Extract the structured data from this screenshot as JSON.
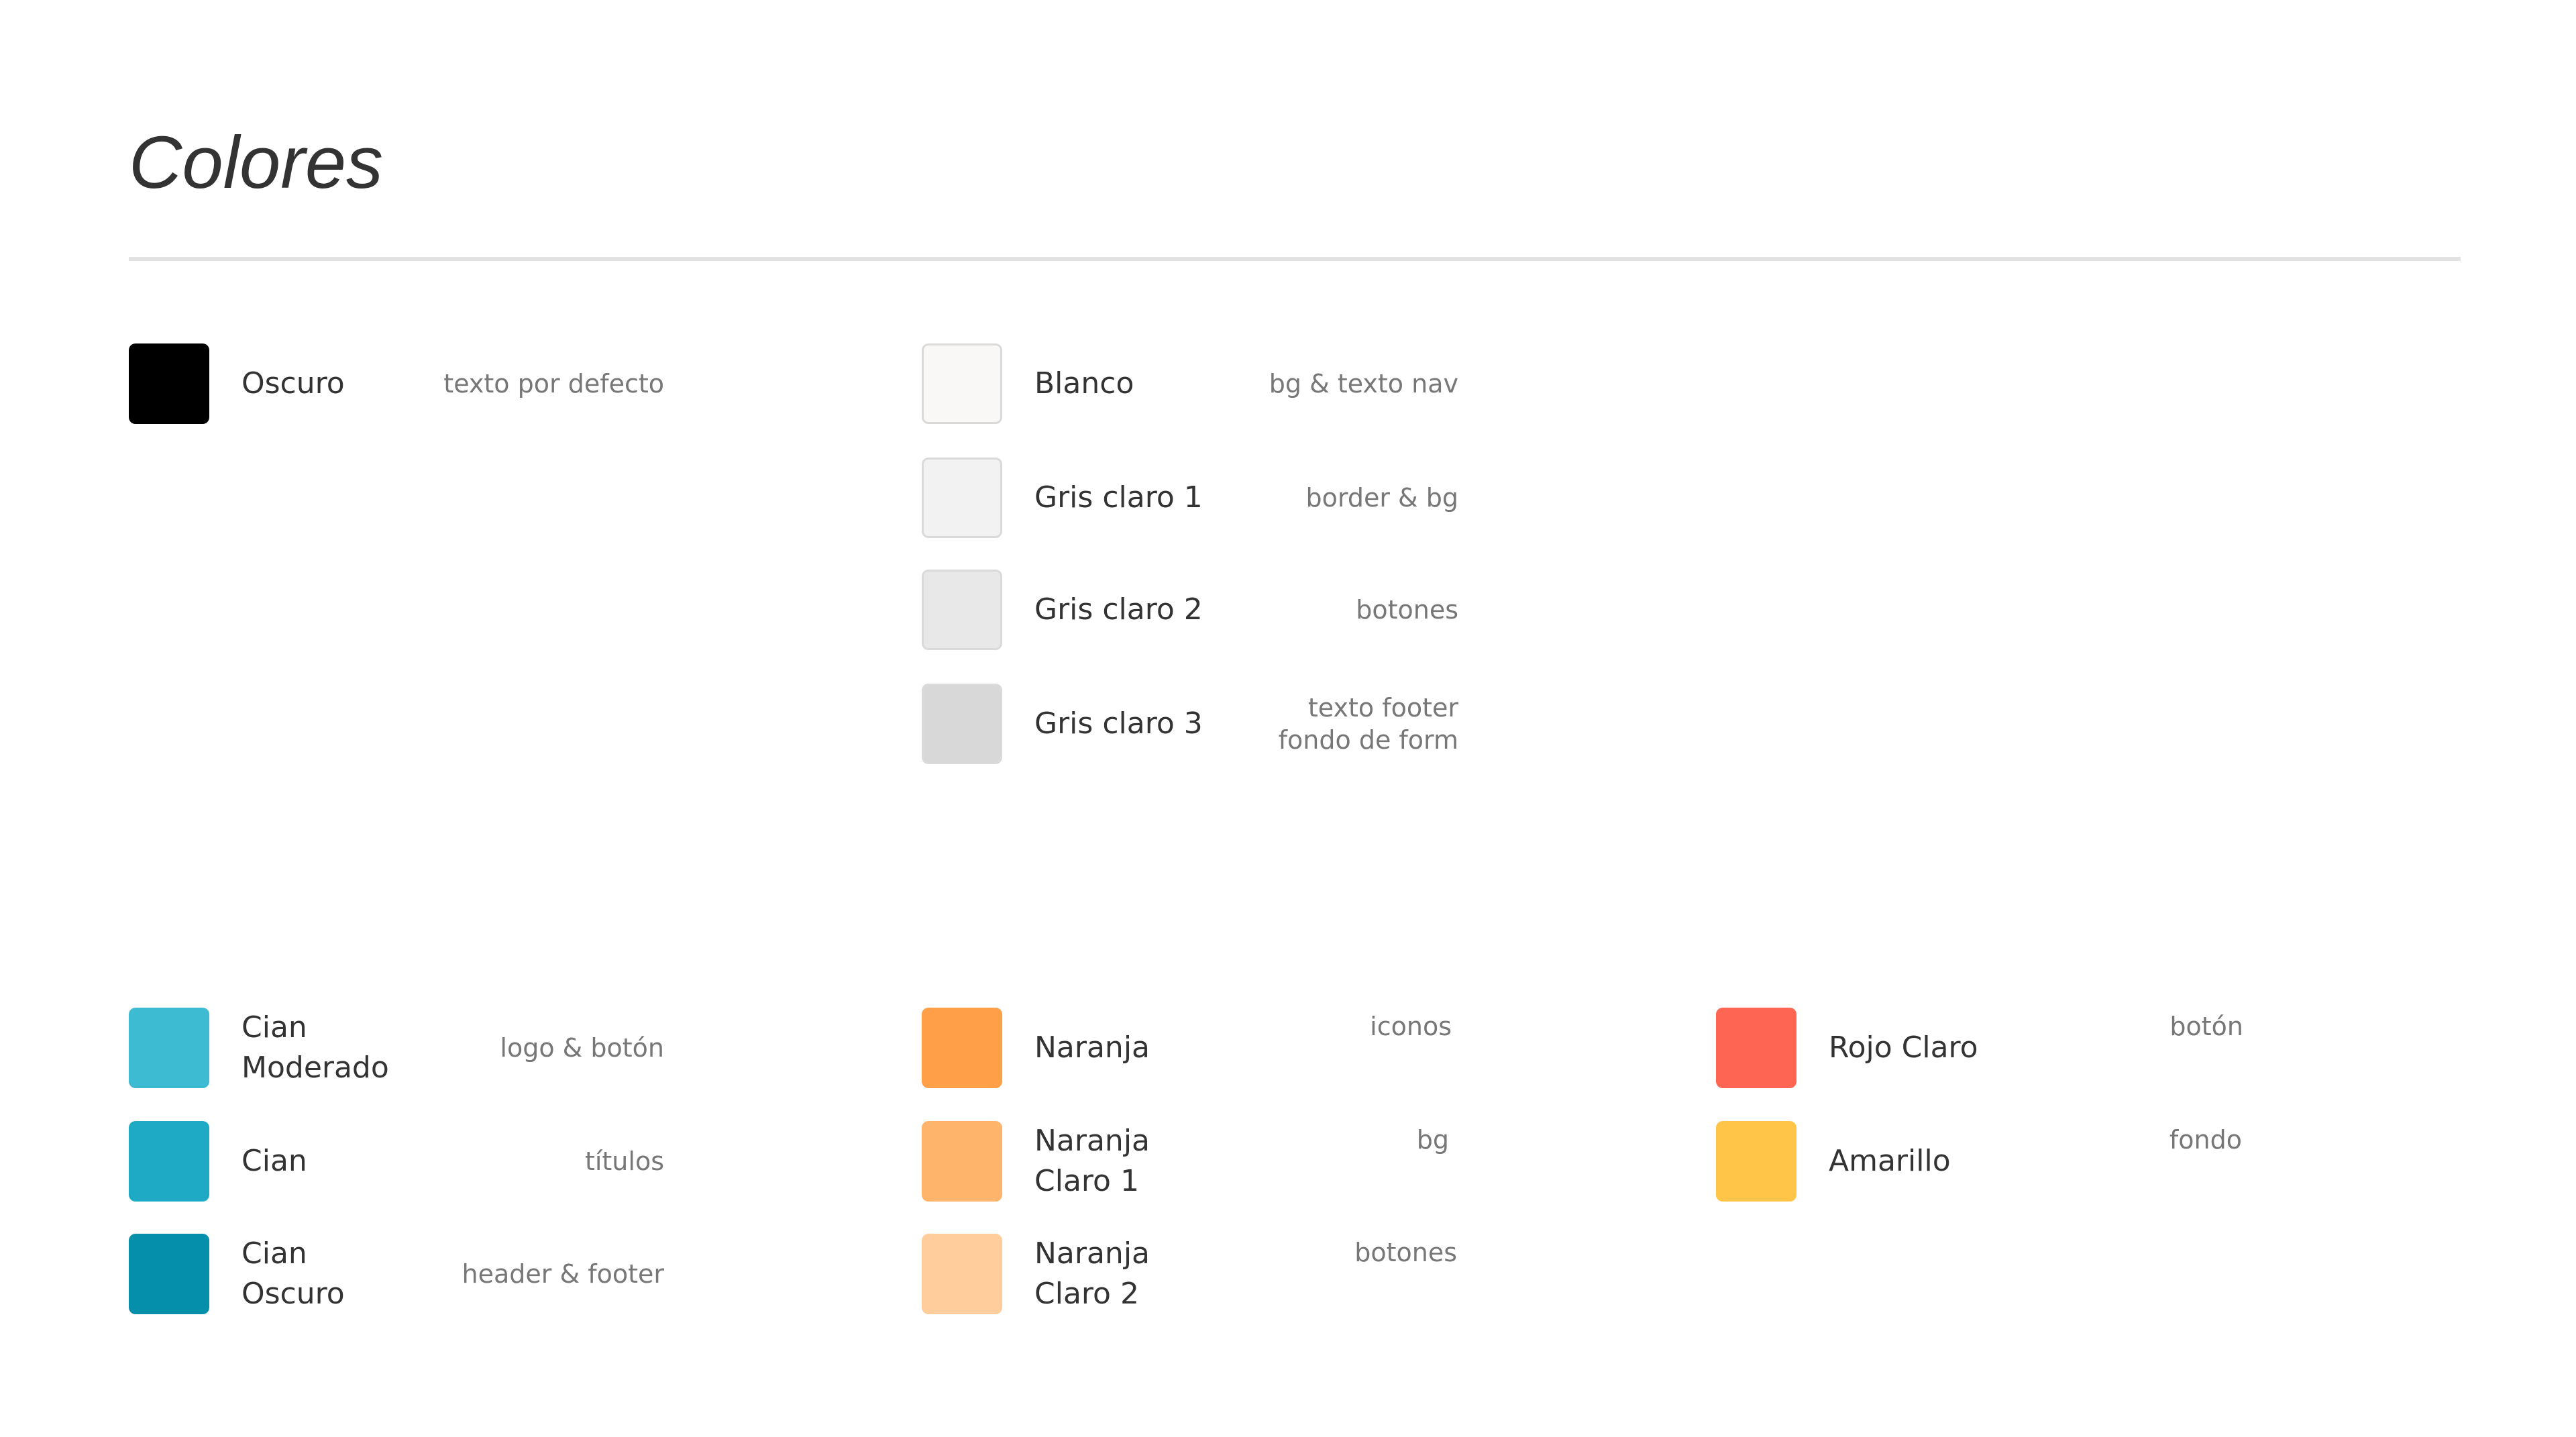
{
  "title": "Colores",
  "colors": [
    {
      "name": "Oscuro",
      "desc": "texto por defecto",
      "hex": "#000000"
    },
    {
      "name": "Blanco",
      "desc": "bg & texto nav",
      "hex": "#f9f8f7"
    },
    {
      "name": "Gris claro 1",
      "desc": "border & bg",
      "hex": "#f2f2f2"
    },
    {
      "name": "Gris claro 2",
      "desc": "botones",
      "hex": "#e8e8e8"
    },
    {
      "name": "Gris claro 3",
      "desc": "texto footer\nfondo de form",
      "hex": "#d8d8d8"
    },
    {
      "name": "Cian\nModerado",
      "desc": "logo & botón",
      "hex": "#3dbbd3"
    },
    {
      "name": "Cian",
      "desc": "títulos",
      "hex": "#1eaac5"
    },
    {
      "name": "Cian\nOscuro",
      "desc": "header & footer",
      "hex": "#058fab"
    },
    {
      "name": "Naranja",
      "desc": "iconos",
      "hex": "#ffa048"
    },
    {
      "name": "Naranja\nClaro 1",
      "desc": "bg",
      "hex": "#ffb46c"
    },
    {
      "name": "Naranja\nClaro 2",
      "desc": "botones",
      "hex": "#ffcd9b"
    },
    {
      "name": "Rojo Claro",
      "desc": "botón",
      "hex": "#ff6553"
    },
    {
      "name": "Amarillo",
      "desc": "fondo",
      "hex": "#ffc548"
    }
  ]
}
